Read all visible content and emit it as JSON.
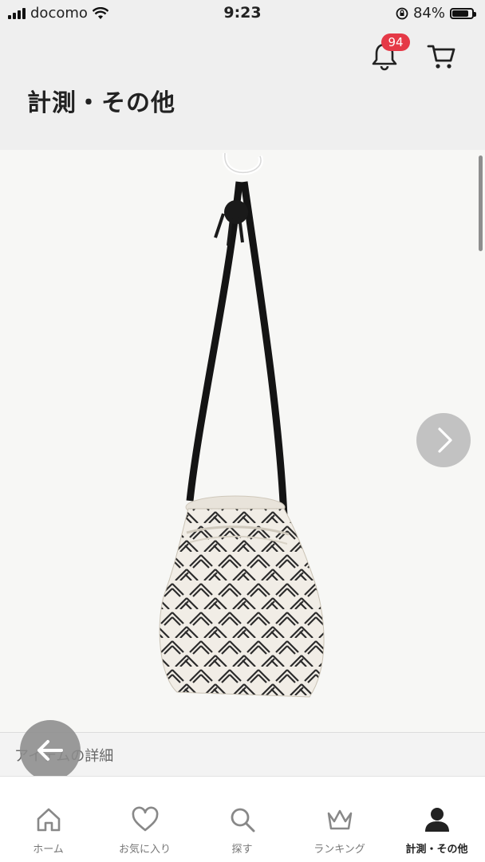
{
  "status_bar": {
    "carrier": "docomo",
    "time": "9:23",
    "battery": "84%",
    "battery_level": 0.84
  },
  "header": {
    "title": "計測・その他",
    "notification_count": "94",
    "accent_color": "#e53947"
  },
  "photo": {
    "description_row_label": "アイテムの詳細"
  },
  "icons": [
    "bell-icon",
    "cart-icon",
    "chevron-right-icon",
    "arrow-left-icon"
  ],
  "tabbar": {
    "tabs": [
      {
        "label": "ホーム",
        "icon": "home-icon"
      },
      {
        "label": "お気に入り",
        "icon": "heart-icon"
      },
      {
        "label": "探す",
        "icon": "search-icon"
      },
      {
        "label": "ランキング",
        "icon": "crown-icon"
      },
      {
        "label": "計測・その他",
        "icon": "person-icon",
        "active": true
      }
    ]
  }
}
